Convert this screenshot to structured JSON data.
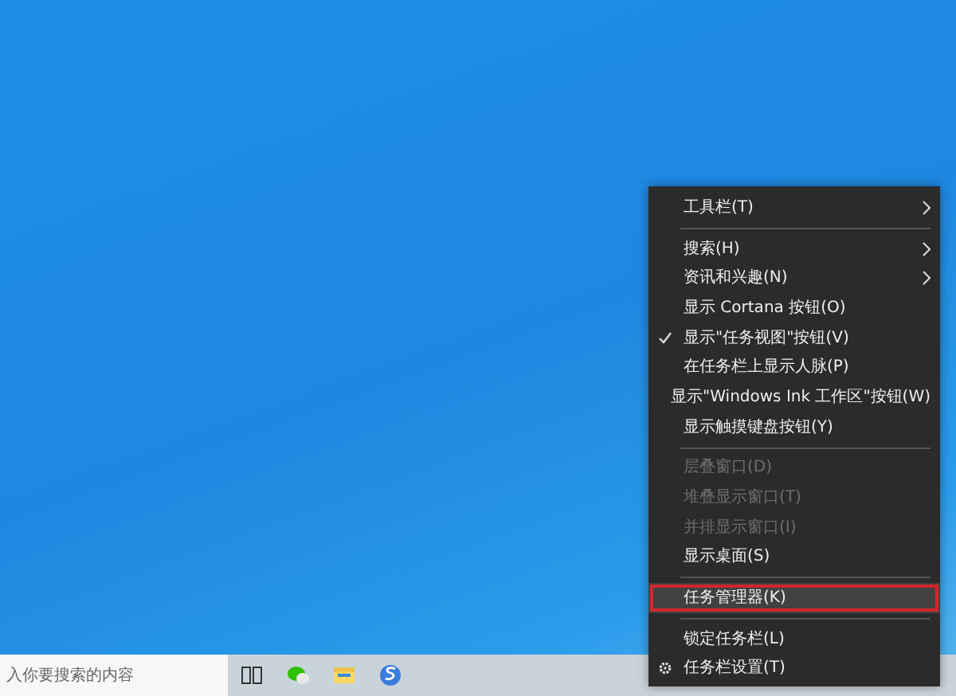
{
  "context_menu": {
    "items": [
      {
        "kind": "item",
        "label": "工具栏(T)",
        "submenu": true,
        "checked": false,
        "disabled": false,
        "selected": false,
        "outlined": false
      },
      {
        "kind": "separator"
      },
      {
        "kind": "item",
        "label": "搜索(H)",
        "submenu": true,
        "checked": false,
        "disabled": false,
        "selected": false,
        "outlined": false
      },
      {
        "kind": "item",
        "label": "资讯和兴趣(N)",
        "submenu": true,
        "checked": false,
        "disabled": false,
        "selected": false,
        "outlined": false
      },
      {
        "kind": "item",
        "label": "显示 Cortana 按钮(O)",
        "submenu": false,
        "checked": false,
        "disabled": false,
        "selected": false,
        "outlined": false
      },
      {
        "kind": "item",
        "label": "显示\"任务视图\"按钮(V)",
        "submenu": false,
        "checked": true,
        "disabled": false,
        "selected": false,
        "outlined": false
      },
      {
        "kind": "item",
        "label": "在任务栏上显示人脉(P)",
        "submenu": false,
        "checked": false,
        "disabled": false,
        "selected": false,
        "outlined": false
      },
      {
        "kind": "item",
        "label": "显示\"Windows Ink 工作区\"按钮(W)",
        "submenu": false,
        "checked": false,
        "disabled": false,
        "selected": false,
        "outlined": false
      },
      {
        "kind": "item",
        "label": "显示触摸键盘按钮(Y)",
        "submenu": false,
        "checked": false,
        "disabled": false,
        "selected": false,
        "outlined": false
      },
      {
        "kind": "separator"
      },
      {
        "kind": "item",
        "label": "层叠窗口(D)",
        "submenu": false,
        "checked": false,
        "disabled": true,
        "selected": false,
        "outlined": false
      },
      {
        "kind": "item",
        "label": "堆叠显示窗口(T)",
        "submenu": false,
        "checked": false,
        "disabled": true,
        "selected": false,
        "outlined": false
      },
      {
        "kind": "item",
        "label": "并排显示窗口(I)",
        "submenu": false,
        "checked": false,
        "disabled": true,
        "selected": false,
        "outlined": false
      },
      {
        "kind": "item",
        "label": "显示桌面(S)",
        "submenu": false,
        "checked": false,
        "disabled": false,
        "selected": false,
        "outlined": false
      },
      {
        "kind": "separator"
      },
      {
        "kind": "item",
        "label": "任务管理器(K)",
        "submenu": false,
        "checked": false,
        "disabled": false,
        "selected": true,
        "outlined": true
      },
      {
        "kind": "separator"
      },
      {
        "kind": "item",
        "label": "锁定任务栏(L)",
        "submenu": false,
        "checked": false,
        "disabled": false,
        "selected": false,
        "outlined": false
      },
      {
        "kind": "settings",
        "label": "任务栏设置(T)",
        "submenu": false,
        "checked": false,
        "disabled": false,
        "selected": false,
        "outlined": false
      }
    ]
  },
  "taskbar": {
    "search": {
      "placeholder": "入你要搜索的内容"
    }
  }
}
